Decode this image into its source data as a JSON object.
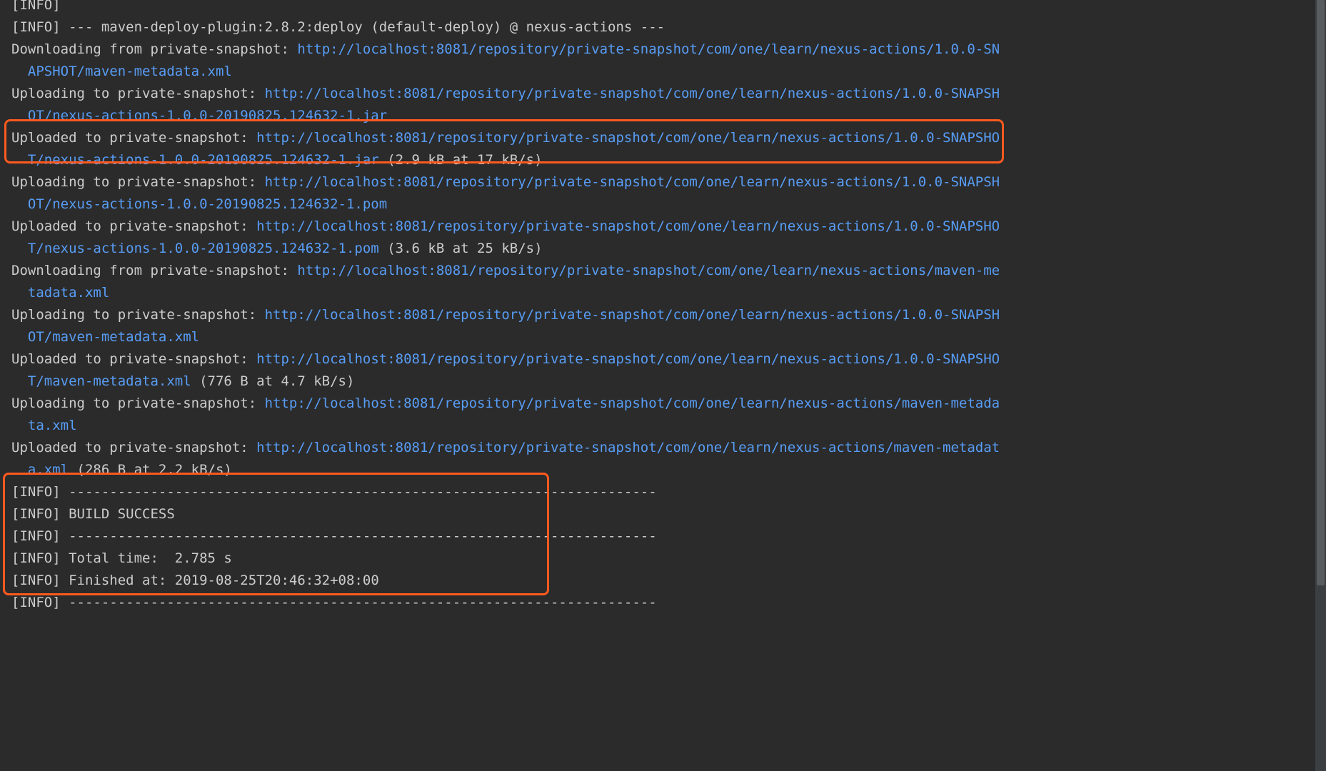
{
  "lines": [
    {
      "parts": [
        {
          "t": "txt",
          "v": "[INFO]"
        }
      ]
    },
    {
      "parts": [
        {
          "t": "txt",
          "v": "[INFO] --- maven-deploy-plugin:2.8.2:deploy (default-deploy) @ nexus-actions ---"
        }
      ]
    },
    {
      "parts": [
        {
          "t": "txt",
          "v": "Downloading from private-snapshot: "
        },
        {
          "t": "url",
          "v": "http://localhost:8081/repository/private-snapshot/com/one/learn/nexus-actions/1.0.0-SNAPSHOT/maven-metadata.xml"
        }
      ]
    },
    {
      "parts": [
        {
          "t": "txt",
          "v": "Uploading to private-snapshot: "
        },
        {
          "t": "url",
          "v": "http://localhost:8081/repository/private-snapshot/com/one/learn/nexus-actions/1.0.0-SNAPSHOT/nexus-actions-1.0.0-20190825.124632-1.jar"
        }
      ]
    },
    {
      "parts": [
        {
          "t": "txt",
          "v": "Uploaded to private-snapshot: "
        },
        {
          "t": "url",
          "v": "http://localhost:8081/repository/private-snapshot/com/one/learn/nexus-actions/1.0.0-SNAPSHOT/nexus-actions-1.0.0-20190825.124632-1.jar"
        },
        {
          "t": "txt",
          "v": " (2.9 kB at 17 kB/s)"
        }
      ]
    },
    {
      "parts": [
        {
          "t": "txt",
          "v": "Uploading to private-snapshot: "
        },
        {
          "t": "url",
          "v": "http://localhost:8081/repository/private-snapshot/com/one/learn/nexus-actions/1.0.0-SNAPSHOT/nexus-actions-1.0.0-20190825.124632-1.pom"
        }
      ]
    },
    {
      "parts": [
        {
          "t": "txt",
          "v": "Uploaded to private-snapshot: "
        },
        {
          "t": "url",
          "v": "http://localhost:8081/repository/private-snapshot/com/one/learn/nexus-actions/1.0.0-SNAPSHOT/nexus-actions-1.0.0-20190825.124632-1.pom"
        },
        {
          "t": "txt",
          "v": " (3.6 kB at 25 kB/s)"
        }
      ]
    },
    {
      "parts": [
        {
          "t": "txt",
          "v": "Downloading from private-snapshot: "
        },
        {
          "t": "url",
          "v": "http://localhost:8081/repository/private-snapshot/com/one/learn/nexus-actions/maven-metadata.xml"
        }
      ]
    },
    {
      "parts": [
        {
          "t": "txt",
          "v": "Uploading to private-snapshot: "
        },
        {
          "t": "url",
          "v": "http://localhost:8081/repository/private-snapshot/com/one/learn/nexus-actions/1.0.0-SNAPSHOT/maven-metadata.xml"
        }
      ]
    },
    {
      "parts": [
        {
          "t": "txt",
          "v": "Uploaded to private-snapshot: "
        },
        {
          "t": "url",
          "v": "http://localhost:8081/repository/private-snapshot/com/one/learn/nexus-actions/1.0.0-SNAPSHOT/maven-metadata.xml"
        },
        {
          "t": "txt",
          "v": " (776 B at 4.7 kB/s)"
        }
      ]
    },
    {
      "parts": [
        {
          "t": "txt",
          "v": "Uploading to private-snapshot: "
        },
        {
          "t": "url",
          "v": "http://localhost:8081/repository/private-snapshot/com/one/learn/nexus-actions/maven-metadata.xml"
        }
      ]
    },
    {
      "parts": [
        {
          "t": "txt",
          "v": "Uploaded to private-snapshot: "
        },
        {
          "t": "url",
          "v": "http://localhost:8081/repository/private-snapshot/com/one/learn/nexus-actions/maven-metadata.xml"
        },
        {
          "t": "txt",
          "v": " (286 B at 2.2 kB/s)"
        }
      ]
    },
    {
      "parts": [
        {
          "t": "txt",
          "v": "[INFO] ------------------------------------------------------------------------"
        }
      ]
    },
    {
      "parts": [
        {
          "t": "txt",
          "v": "[INFO] BUILD SUCCESS"
        }
      ]
    },
    {
      "parts": [
        {
          "t": "txt",
          "v": "[INFO] ------------------------------------------------------------------------"
        }
      ]
    },
    {
      "parts": [
        {
          "t": "txt",
          "v": "[INFO] Total time:  2.785 s"
        }
      ]
    },
    {
      "parts": [
        {
          "t": "txt",
          "v": "[INFO] Finished at: 2019-08-25T20:46:32+08:00"
        }
      ]
    },
    {
      "parts": [
        {
          "t": "txt",
          "v": "[INFO] ------------------------------------------------------------------------"
        }
      ]
    }
  ]
}
